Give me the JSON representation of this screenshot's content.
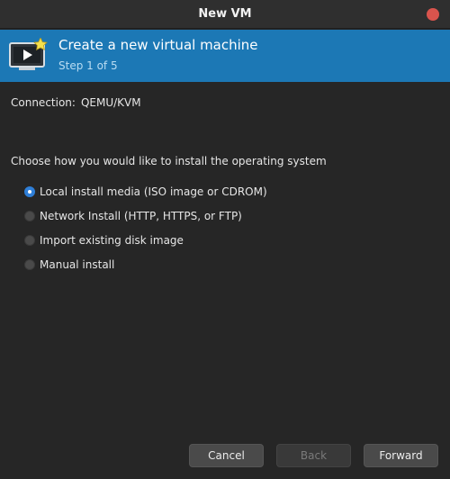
{
  "window": {
    "title": "New VM"
  },
  "banner": {
    "title": "Create a new virtual machine",
    "step": "Step 1 of 5",
    "icon": "monitor-play-star-icon"
  },
  "connection": {
    "label": "Connection:",
    "value": "QEMU/KVM"
  },
  "install": {
    "prompt": "Choose how you would like to install the operating system",
    "options": [
      {
        "label": "Local install media (ISO image or CDROM)",
        "selected": true
      },
      {
        "label": "Network Install (HTTP, HTTPS, or FTP)",
        "selected": false
      },
      {
        "label": "Import existing disk image",
        "selected": false
      },
      {
        "label": "Manual install",
        "selected": false
      }
    ]
  },
  "buttons": {
    "cancel": "Cancel",
    "back": "Back",
    "forward": "Forward",
    "back_enabled": false
  },
  "colors": {
    "banner": "#1c78b5",
    "close": "#d9544d",
    "radio_selected": "#2f7fd8"
  }
}
